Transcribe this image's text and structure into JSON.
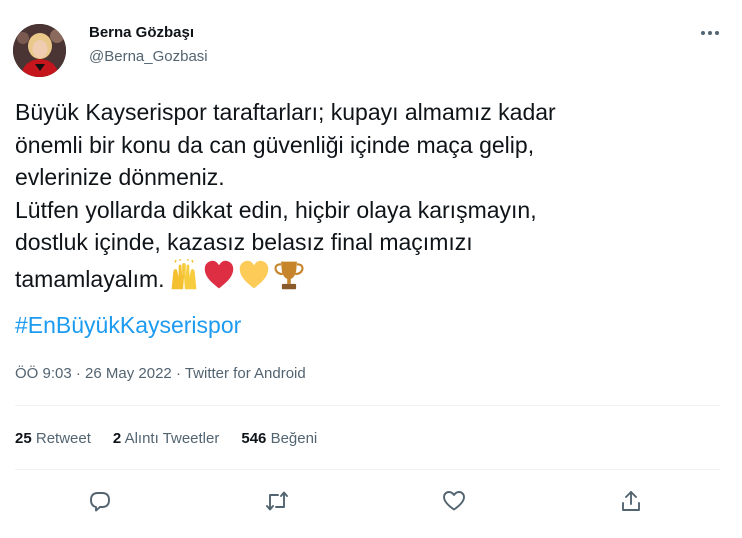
{
  "author": {
    "name": "Berna Gözbaşı",
    "handle": "@Berna_Gozbasi"
  },
  "tweet": {
    "text": "Büyük Kayserispor taraftarları; kupayı almamız kadar\nönemli bir konu da can güvenliği içinde maça gelip,\nevlerinize dönmeniz.\nLütfen yollarda dikkat edin, hiçbir olaya karışmayın,\ndostluk içinde, kazasız belasız final maçımızı\ntamamlayalım.",
    "emojis": [
      "raising-hands-icon",
      "red-heart-icon",
      "yellow-heart-icon",
      "trophy-icon"
    ],
    "hashtag": "#EnBüyükKayserispor"
  },
  "meta": {
    "time": "ÖÖ 9:03",
    "separator1": " · ",
    "date": "26 May 2022",
    "separator2": " · ",
    "source": "Twitter for Android"
  },
  "stats": {
    "retweets_count": "25",
    "retweets_label": "Retweet",
    "quotes_count": "2",
    "quotes_label": "Alıntı Tweetler",
    "likes_count": "546",
    "likes_label": "Beğeni"
  },
  "actions": [
    "reply-icon",
    "retweet-icon",
    "like-icon",
    "share-icon"
  ],
  "colors": {
    "text": "#0f1419",
    "secondary": "#536471",
    "link": "#1d9bf0",
    "divider": "#eff3f4"
  }
}
